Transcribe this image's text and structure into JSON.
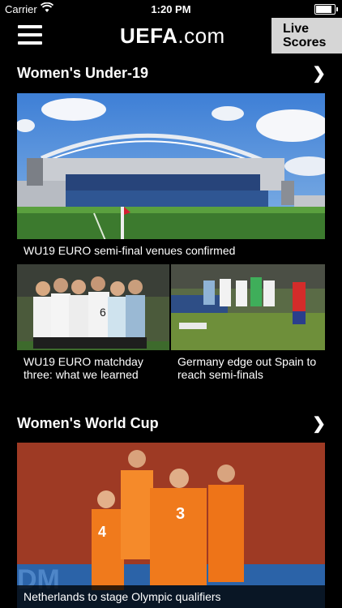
{
  "status_bar": {
    "carrier": "Carrier",
    "time": "1:20 PM",
    "battery_level": 0.95
  },
  "nav": {
    "logo_bold": "UEFA",
    "logo_suffix": ".com",
    "live_line1": "Live",
    "live_line2": "Scores"
  },
  "sections": [
    {
      "title": "Women's Under-19",
      "articles": [
        {
          "headline": "WU19 EURO semi-final venues confirmed"
        },
        {
          "headline": "WU19 EURO matchday three: what we learned"
        },
        {
          "headline": "Germany edge out Spain to reach semi-finals"
        }
      ]
    },
    {
      "title": "Women's World Cup",
      "articles": [
        {
          "headline": "Netherlands to stage Olympic qualifiers"
        }
      ]
    }
  ],
  "colors": {
    "background": "#000000",
    "live_button": "#d6d6d6",
    "orange_kit": "#f07a1c"
  },
  "icons": {
    "menu": "hamburger-icon",
    "chevron": "chevron-right-icon",
    "wifi": "wifi-icon",
    "battery": "battery-icon"
  }
}
